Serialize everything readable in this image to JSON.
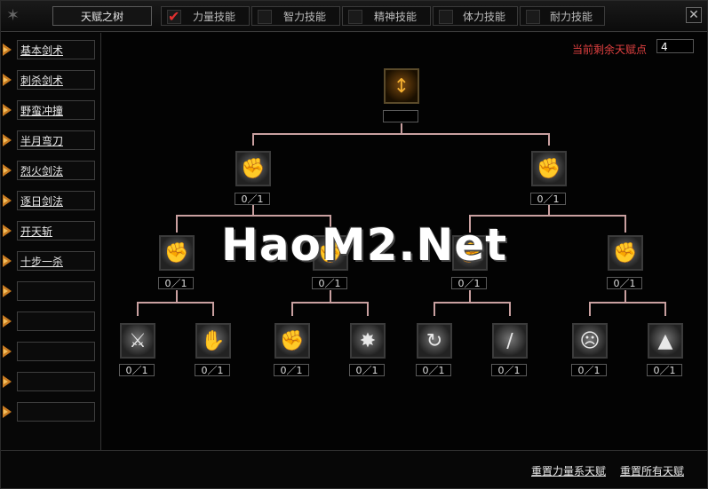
{
  "header": {
    "tabs": [
      {
        "label": "天赋之树",
        "checked": null
      },
      {
        "label": "力量技能",
        "checked": true
      },
      {
        "label": "智力技能",
        "checked": false
      },
      {
        "label": "精神技能",
        "checked": false
      },
      {
        "label": "体力技能",
        "checked": false
      },
      {
        "label": "耐力技能",
        "checked": false
      }
    ],
    "close_label": "✕"
  },
  "sidebar": {
    "items": [
      {
        "label": "基本剑术"
      },
      {
        "label": "刺杀剑术"
      },
      {
        "label": "野蛮冲撞"
      },
      {
        "label": "半月弯刀"
      },
      {
        "label": "烈火剑法"
      },
      {
        "label": "逐日剑法"
      },
      {
        "label": "开天斩"
      },
      {
        "label": "十步一杀"
      },
      {
        "label": ""
      },
      {
        "label": ""
      },
      {
        "label": ""
      },
      {
        "label": ""
      },
      {
        "label": ""
      }
    ]
  },
  "main": {
    "remaining_points_label": "当前剩余天赋点",
    "remaining_points_value": "4",
    "watermark": "HaoM2.Net",
    "root": {
      "icon": "sword-up-icon",
      "count": ""
    },
    "level1": [
      {
        "icon": "power-fist-icon",
        "count": "0／1"
      },
      {
        "icon": "power-fist-icon",
        "count": "0／1"
      }
    ],
    "level2": [
      {
        "icon": "fist-icon",
        "count": "0／1"
      },
      {
        "icon": "fist-icon",
        "count": "0／1"
      },
      {
        "icon": "fist-icon",
        "count": "0／1"
      },
      {
        "icon": "fist-icon",
        "count": "0／1"
      }
    ],
    "level3": [
      {
        "icon": "warrior-strike-icon",
        "count": "0／1"
      },
      {
        "icon": "energy-palm-icon",
        "count": "0／1"
      },
      {
        "icon": "fist-icon",
        "count": "0／1"
      },
      {
        "icon": "punch-blast-icon",
        "count": "0／1"
      },
      {
        "icon": "whirlwind-icon",
        "count": "0／1"
      },
      {
        "icon": "blade-slash-icon",
        "count": "0／1"
      },
      {
        "icon": "shadow-figures-icon",
        "count": "0／1"
      },
      {
        "icon": "rock-shard-icon",
        "count": "0／1"
      }
    ]
  },
  "bottom": {
    "reset_strength_label": "重置力量系天赋",
    "reset_all_label": "重置所有天赋"
  }
}
